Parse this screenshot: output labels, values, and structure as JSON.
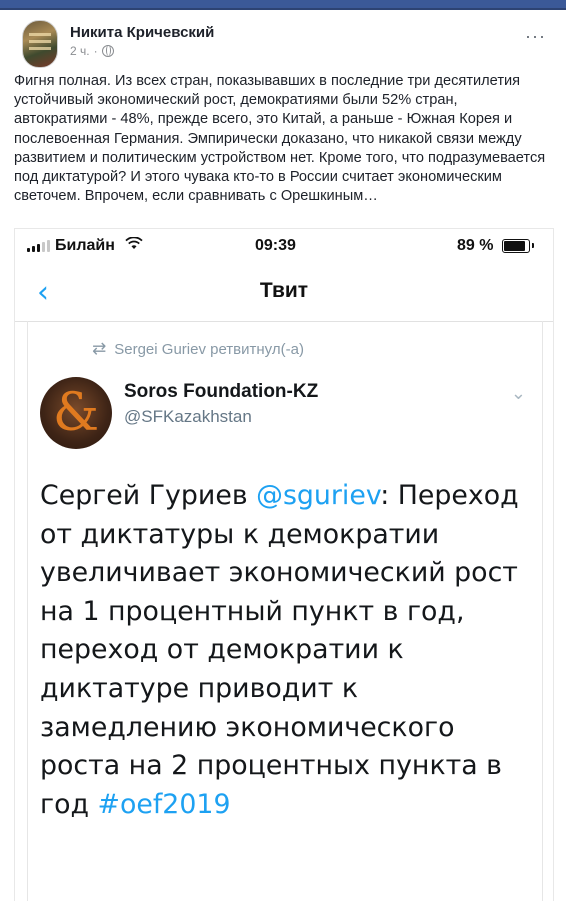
{
  "post": {
    "author": "Никита Кричевский",
    "time": "2 ч.",
    "separator": "·",
    "more": "···",
    "text": "Фигня полная. Из всех стран, показывавших в последние три десятилетия устойчивый экономический рост, демократиями были 52% стран, автократиями - 48%, прежде всего, это Китай, а раньше - Южная Корея и послевоенная Германия. Эмпирически доказано, что никакой связи между развитием и политическим устройством нет. Кроме того, что подразумевается под диктатурой? И этого чувака кто-то в России считает экономическим светочем. Впрочем, если сравнивать с Орешкиным…"
  },
  "phone": {
    "carrier": "Билайн",
    "time": "09:39",
    "battery": "89 %",
    "nav_back": "‹",
    "nav_title": "Твит"
  },
  "tweet": {
    "retweet_icon": "⇄",
    "retweeted_by": "Sergei Guriev ретвитнул(-а)",
    "author_name": "Soros Foundation-KZ",
    "author_handle": "@SFKazakhstan",
    "caret": "⌄",
    "body_before": "Сергей Гуриев ",
    "mention": "@sguriev",
    "body_after": ": Переход от диктатуры к демократии увеличивает экономический рост на 1 процентный пункт в год, переход от демократии к диктатуре приводит к замедлению экономического роста на 2 процентных пункта в год ",
    "hashtag": "#oef2019"
  },
  "colors": {
    "facebook_blue": "#3b5998",
    "twitter_blue": "#1da1f2"
  }
}
